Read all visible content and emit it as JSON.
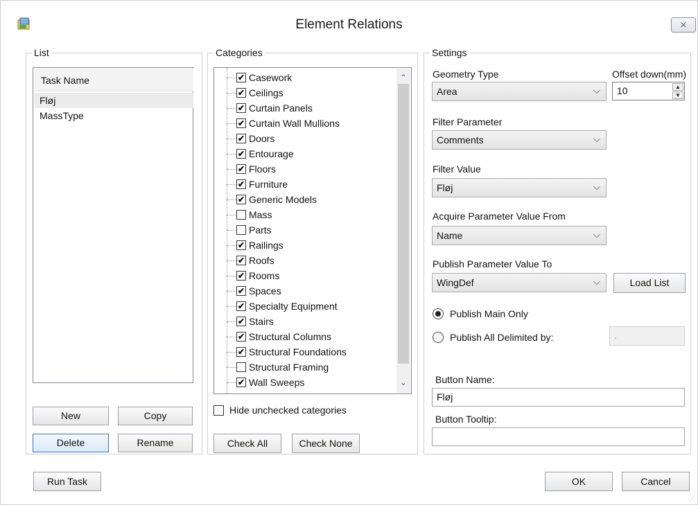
{
  "window": {
    "title": "Element Relations",
    "close_glyph": "⨯",
    "app_icon": "app-icon"
  },
  "list_group": {
    "legend": "List",
    "header": "Task Name",
    "items": [
      "Fløj",
      "MassType"
    ],
    "buttons": {
      "new": "New",
      "copy": "Copy",
      "delete": "Delete",
      "rename": "Rename"
    }
  },
  "categories_group": {
    "legend": "Categories",
    "items": [
      {
        "label": "Casework",
        "checked": true
      },
      {
        "label": "Ceilings",
        "checked": true
      },
      {
        "label": "Curtain Panels",
        "checked": true
      },
      {
        "label": "Curtain Wall Mullions",
        "checked": true
      },
      {
        "label": "Doors",
        "checked": true
      },
      {
        "label": "Entourage",
        "checked": true
      },
      {
        "label": "Floors",
        "checked": true
      },
      {
        "label": "Furniture",
        "checked": true
      },
      {
        "label": "Generic Models",
        "checked": true
      },
      {
        "label": "Mass",
        "checked": false
      },
      {
        "label": "Parts",
        "checked": false
      },
      {
        "label": "Railings",
        "checked": true
      },
      {
        "label": "Roofs",
        "checked": true
      },
      {
        "label": "Rooms",
        "checked": true
      },
      {
        "label": "Spaces",
        "checked": true
      },
      {
        "label": "Specialty Equipment",
        "checked": true
      },
      {
        "label": "Stairs",
        "checked": true
      },
      {
        "label": "Structural Columns",
        "checked": true
      },
      {
        "label": "Structural Foundations",
        "checked": true
      },
      {
        "label": "Structural Framing",
        "checked": false
      },
      {
        "label": "Wall Sweeps",
        "checked": true
      }
    ],
    "hide_unchecked_label": "Hide unchecked categories",
    "hide_unchecked_checked": false,
    "check_all": "Check All",
    "check_none": "Check None"
  },
  "settings_group": {
    "legend": "Settings",
    "geometry_type_label": "Geometry Type",
    "geometry_type_value": "Area",
    "offset_label": "Offset down(mm)",
    "offset_value": "10",
    "filter_parameter_label": "Filter Parameter",
    "filter_parameter_value": "Comments",
    "filter_value_label": "Filter Value",
    "filter_value_value": "Fløj",
    "acquire_label": "Acquire Parameter Value From",
    "acquire_value": "Name",
    "publish_label": "Publish Parameter Value To",
    "publish_value": "WingDef",
    "load_list": "Load List",
    "radio_main": "Publish Main Only",
    "radio_main_checked": true,
    "radio_delimited": "Publish All Delimited by:",
    "radio_delimited_checked": false,
    "delimiter_value": ".",
    "button_name_label": "Button Name:",
    "button_name_value": "Fløj",
    "button_tooltip_label": "Button Tooltip:",
    "button_tooltip_value": ""
  },
  "footer": {
    "run_task": "Run Task",
    "ok": "OK",
    "cancel": "Cancel"
  },
  "icons": {
    "dropdown": "chevron-down-icon",
    "check": "checkmark-icon"
  }
}
